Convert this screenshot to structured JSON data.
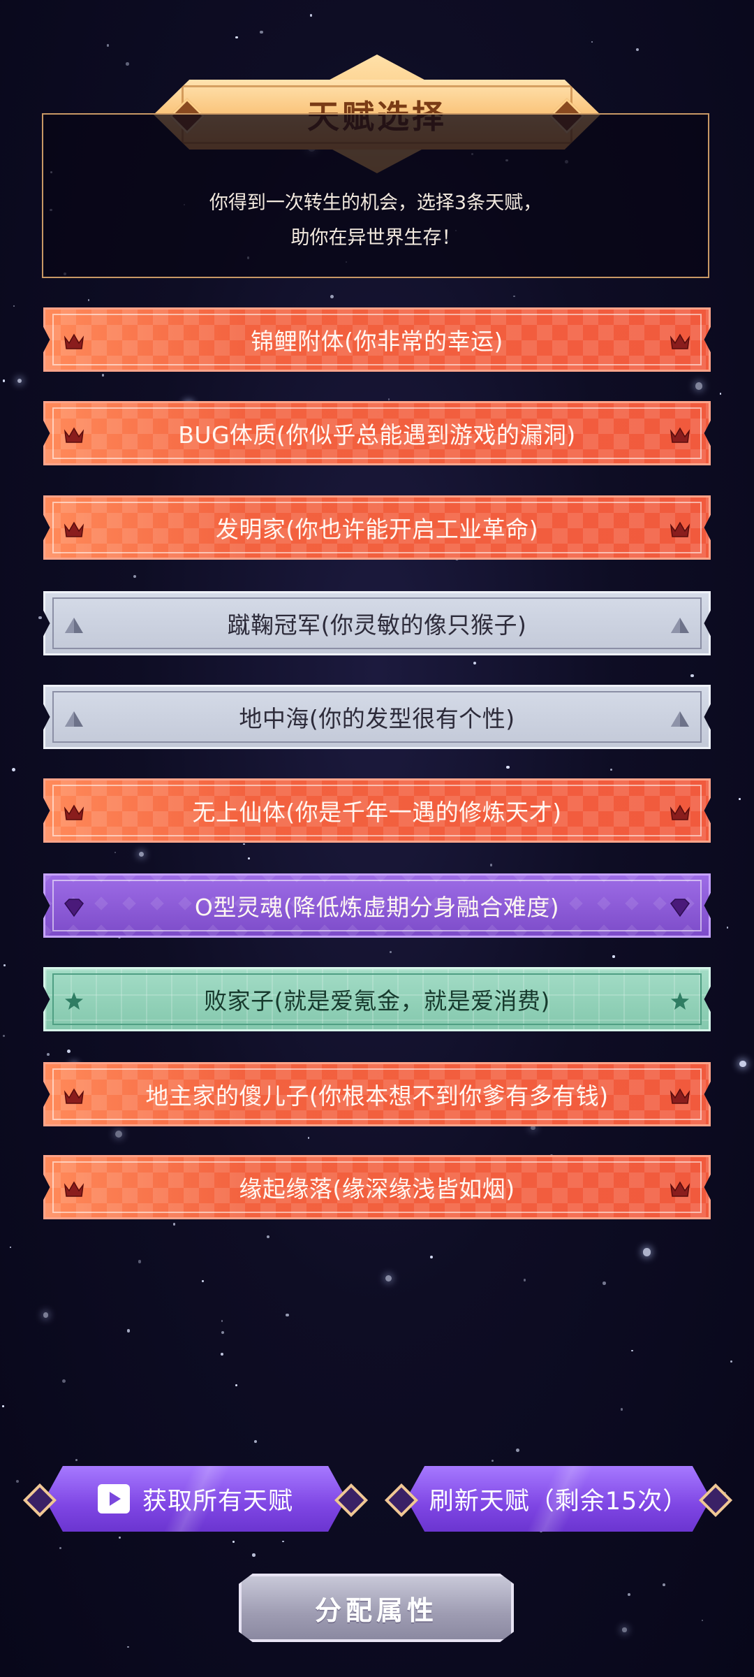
{
  "title": "天赋选择",
  "intro": {
    "line1": "你得到一次转生的机会，选择3条天赋，",
    "line2": "助你在异世界生存！"
  },
  "talents": [
    {
      "label": "锦鲤附体(你非常的幸运)",
      "rarity": "orange",
      "icon": "crown-icon"
    },
    {
      "label": "BUG体质(你似乎总能遇到游戏的漏洞)",
      "rarity": "orange",
      "icon": "crown-icon"
    },
    {
      "label": "发明家(你也许能开启工业革命)",
      "rarity": "orange",
      "icon": "crown-icon"
    },
    {
      "label": "蹴鞠冠军(你灵敏的像只猴子)",
      "rarity": "grey",
      "icon": "triangle-icon"
    },
    {
      "label": "地中海(你的发型很有个性)",
      "rarity": "grey",
      "icon": "triangle-icon"
    },
    {
      "label": "无上仙体(你是千年一遇的修炼天才)",
      "rarity": "orange",
      "icon": "crown-icon"
    },
    {
      "label": "O型灵魂(降低炼虚期分身融合难度)",
      "rarity": "purple",
      "icon": "gem-icon"
    },
    {
      "label": "败家子(就是爱氪金，就是爱消费)",
      "rarity": "green",
      "icon": "star-icon"
    },
    {
      "label": "地主家的傻儿子(你根本想不到你爹有多有钱)",
      "rarity": "orange",
      "icon": "crown-icon"
    },
    {
      "label": "缘起缘落(缘深缘浅皆如烟)",
      "rarity": "orange",
      "icon": "crown-icon"
    }
  ],
  "buttons": {
    "get_all": "获取所有天赋",
    "refresh": "刷新天赋（剩余15次）",
    "allocate": "分配属性"
  },
  "colors": {
    "orange": "#f46a4a",
    "grey": "#c9cfdd",
    "purple": "#8c5bd7",
    "green": "#8fd1b8",
    "title_gold": "#f8b765"
  }
}
